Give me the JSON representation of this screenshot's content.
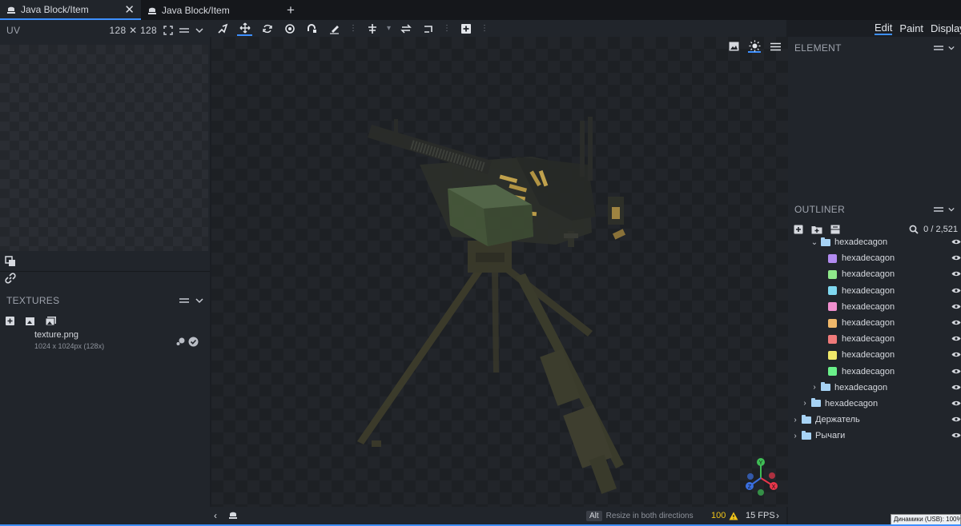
{
  "tabs": [
    {
      "label": "Java Block/Item",
      "active": true,
      "close": "✕"
    },
    {
      "label": "Java Block/Item",
      "active": false
    }
  ],
  "new_tab_label": "+",
  "uv": {
    "title": "UV",
    "size": "128 ✕ 128"
  },
  "textures": {
    "title": "TEXTURES",
    "items": [
      {
        "name": "texture.png",
        "meta": "1024 x 1024px (128x)"
      }
    ]
  },
  "toolbar": {
    "tools": [
      "pivot-tool-icon",
      "move-tool-icon",
      "rotate-tool-icon",
      "resize-tool-icon",
      "vertex-snap-icon",
      "paint-brush-icon",
      "align-icon",
      "mirror-icon",
      "flip-icon",
      "add-cube-icon"
    ]
  },
  "modes": [
    {
      "label": "Edit",
      "active": true
    },
    {
      "label": "Paint",
      "active": false
    },
    {
      "label": "Display",
      "active": false
    }
  ],
  "element": {
    "title": "ELEMENT"
  },
  "outliner": {
    "title": "OUTLINER",
    "counter": "0 / 2,521",
    "rows": [
      {
        "type": "folder",
        "label": "hexadecagon",
        "indent": 2,
        "open": true
      },
      {
        "type": "cube",
        "label": "hexadecagon",
        "indent": 3,
        "color": "#b28bf0"
      },
      {
        "type": "cube",
        "label": "hexadecagon",
        "indent": 3,
        "color": "#8fe88a"
      },
      {
        "type": "cube",
        "label": "hexadecagon",
        "indent": 3,
        "color": "#7fd8f0"
      },
      {
        "type": "cube",
        "label": "hexadecagon",
        "indent": 3,
        "color": "#f08fce"
      },
      {
        "type": "cube",
        "label": "hexadecagon",
        "indent": 3,
        "color": "#f0b86a"
      },
      {
        "type": "cube",
        "label": "hexadecagon",
        "indent": 3,
        "color": "#f07a7a"
      },
      {
        "type": "cube",
        "label": "hexadecagon",
        "indent": 3,
        "color": "#f0e86a"
      },
      {
        "type": "cube",
        "label": "hexadecagon",
        "indent": 3,
        "color": "#6af08a"
      },
      {
        "type": "folder",
        "label": "hexadecagon",
        "indent": 2,
        "open": false
      },
      {
        "type": "folder",
        "label": "hexadecagon",
        "indent": 1,
        "open": false
      },
      {
        "type": "folder",
        "label": "Держатель",
        "indent": 0,
        "open": false
      },
      {
        "type": "folder",
        "label": "Рычаги",
        "indent": 0,
        "open": false
      }
    ]
  },
  "status": {
    "key": "Alt",
    "hint": "Resize in both directions",
    "warnings": "100",
    "fps": "15 FPS",
    "prev": "‹",
    "next": "›"
  },
  "tooltip": "Динамики (USB): 100%"
}
